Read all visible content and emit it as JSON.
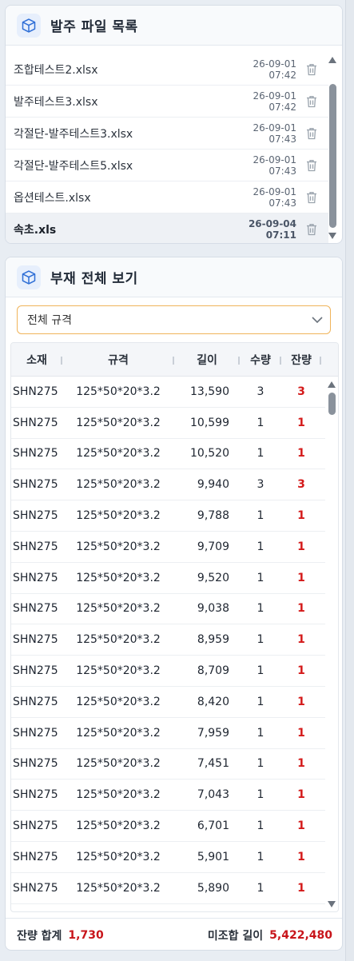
{
  "files_panel": {
    "title": "발주 파일 목록",
    "files": [
      {
        "name": "조합테스트2.xlsx",
        "date": "26-09-01 07:42"
      },
      {
        "name": "발주테스트3.xlsx",
        "date": "26-09-01 07:42"
      },
      {
        "name": "각절단-발주테스트3.xlsx",
        "date": "26-09-01 07:43"
      },
      {
        "name": "각절단-발주테스트5.xlsx",
        "date": "26-09-01 07:43"
      },
      {
        "name": "옵션테스트.xlsx",
        "date": "26-09-01 07:43"
      },
      {
        "name": "속초.xls",
        "date": "26-09-04 07:11"
      }
    ]
  },
  "members_panel": {
    "title": "부재 전체 보기",
    "spec_filter": "전체 규격",
    "columns": [
      "소재",
      "규격",
      "길이",
      "수량",
      "잔량"
    ],
    "rows": [
      [
        "SHN275",
        "125*50*20*3.2",
        "13,590",
        "3",
        "3"
      ],
      [
        "SHN275",
        "125*50*20*3.2",
        "10,599",
        "1",
        "1"
      ],
      [
        "SHN275",
        "125*50*20*3.2",
        "10,520",
        "1",
        "1"
      ],
      [
        "SHN275",
        "125*50*20*3.2",
        "9,940",
        "3",
        "3"
      ],
      [
        "SHN275",
        "125*50*20*3.2",
        "9,788",
        "1",
        "1"
      ],
      [
        "SHN275",
        "125*50*20*3.2",
        "9,709",
        "1",
        "1"
      ],
      [
        "SHN275",
        "125*50*20*3.2",
        "9,520",
        "1",
        "1"
      ],
      [
        "SHN275",
        "125*50*20*3.2",
        "9,038",
        "1",
        "1"
      ],
      [
        "SHN275",
        "125*50*20*3.2",
        "8,959",
        "1",
        "1"
      ],
      [
        "SHN275",
        "125*50*20*3.2",
        "8,709",
        "1",
        "1"
      ],
      [
        "SHN275",
        "125*50*20*3.2",
        "8,420",
        "1",
        "1"
      ],
      [
        "SHN275",
        "125*50*20*3.2",
        "7,959",
        "1",
        "1"
      ],
      [
        "SHN275",
        "125*50*20*3.2",
        "7,451",
        "1",
        "1"
      ],
      [
        "SHN275",
        "125*50*20*3.2",
        "7,043",
        "1",
        "1"
      ],
      [
        "SHN275",
        "125*50*20*3.2",
        "6,701",
        "1",
        "1"
      ],
      [
        "SHN275",
        "125*50*20*3.2",
        "5,901",
        "1",
        "1"
      ],
      [
        "SHN275",
        "125*50*20*3.2",
        "5,890",
        "1",
        "1"
      ]
    ],
    "footer": {
      "remaining_total_label": "잔량 합계",
      "remaining_total_value": "1,730",
      "uncombined_length_label": "미조합 길이",
      "uncombined_length_value": "5,422,480"
    }
  },
  "colors": {
    "accent": "#2f6fd6",
    "remaining": "#d41a1a",
    "select_border": "#f0b45a"
  },
  "icons": {
    "panel_header": "cube-icon",
    "file_delete": "trash-icon",
    "select": "chevron-down-icon"
  }
}
